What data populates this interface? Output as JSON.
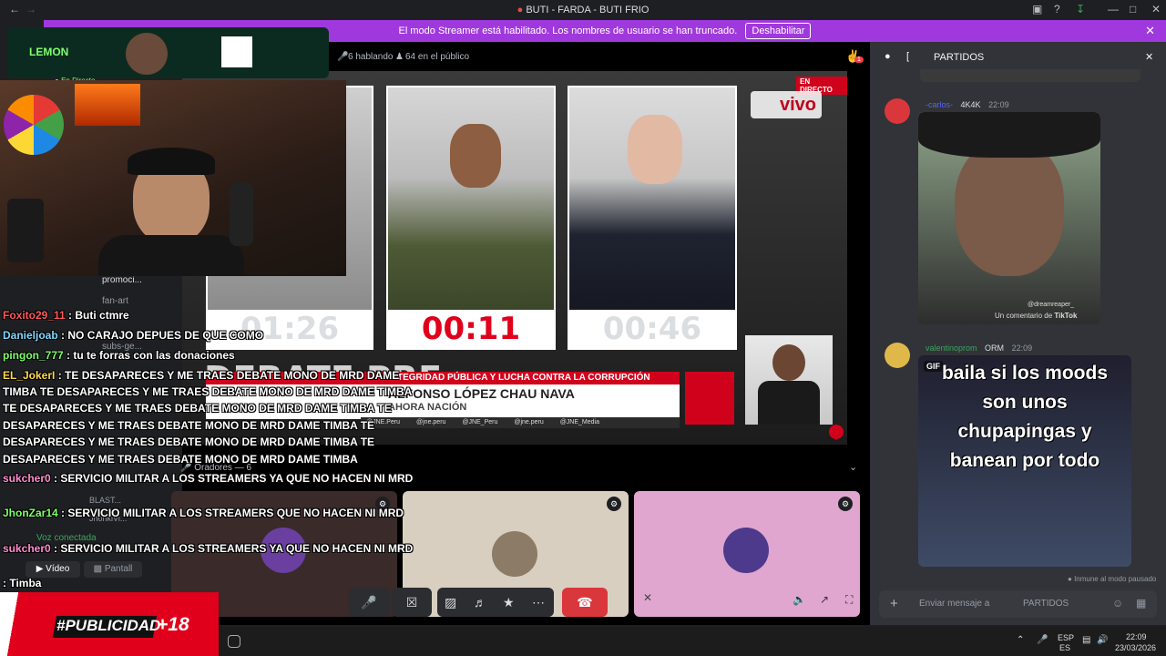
{
  "window": {
    "title": "BUTI - FARDA - BUTI FRIO",
    "controls": [
      "—",
      "□",
      "✕"
    ]
  },
  "banner": {
    "text": "El modo Streamer está habilitado. Los nombres de usuario se han truncado.",
    "button": "Deshabilitar"
  },
  "voice": {
    "talking": "6 hablando",
    "audience": "64 en el público",
    "speakers_label": "Oradores — 6",
    "notif_badge": "1"
  },
  "stage": {
    "live_badge": "EN DIRECTO",
    "vivo": "vivo",
    "timers": [
      "01:26",
      "00:11",
      "00:46"
    ],
    "ticker_red": "INTEGRIDAD PÚBLICA Y LUCHA CONTRA LA CORRUPCIÓN",
    "ticker_name": "ALFONSO LÓPEZ CHAU NAVA",
    "ticker_sub": "AHORA NACIÓN",
    "socials": [
      "@JNE.Peru",
      "@jne.peru",
      "@JNE_Peru",
      "@jne.peru",
      "@JNE_Media"
    ],
    "debate_overlay": "DEBATE PRESIDENCIAL"
  },
  "chat_panel": {
    "channel": "PARTIDOS",
    "msg1": {
      "user": "-carlos-",
      "badge": "4K4K",
      "time": "22:09",
      "caption": "Un comentario de",
      "caption_tag": "TikTok",
      "handle": "@dreamreaper_"
    },
    "msg2": {
      "user": "valentinoprom",
      "badge": "ORM",
      "time": "22:09",
      "gif_label": "GIF",
      "gif_text": "baila si los moods son unos chupapingas y banean por todo"
    },
    "footer_note": "Inmune al modo pausado",
    "input_placeholder": "Enviar mensaje a",
    "input_channel": "PARTIDOS"
  },
  "sidebar": {
    "voice_connected": "Voz conectada",
    "video_btn": "Vídeo",
    "screen_btn": "Pantall"
  },
  "overlay": {
    "brand": "LEMON",
    "live": "En Directo",
    "promo": "#PUBLICIDAD",
    "plus18": "+18"
  },
  "stream_chat": [
    {
      "user": "Foxito29_11",
      "color": "#ff5a5a",
      "text": "Buti ctmre"
    },
    {
      "user": "Danieljoab",
      "color": "#7fd7ff",
      "text": "NO CARAJO DEPUES DE QUE COMO"
    },
    {
      "user": "pingon_777",
      "color": "#7fff6a",
      "text": "tu te forras con las donaciones"
    },
    {
      "user": "EL_JokerI",
      "color": "#ffd84a",
      "text": "TE DESAPARECES Y ME TRAES DEBATE MONO DE MRD DAME"
    },
    {
      "user": "",
      "color": "#fff",
      "text": "TIMBA TE DESAPARECES Y ME TRAES DEBATE MONO DE MRD DAME TIMBA"
    },
    {
      "user": "",
      "color": "#fff",
      "text": "TE DESAPARECES Y ME TRAES DEBATE MONO DE MRD DAME TIMBA TE"
    },
    {
      "user": "",
      "color": "#fff",
      "text": "DESAPARECES Y ME TRAES DEBATE MONO DE MRD DAME TIMBA TE"
    },
    {
      "user": "",
      "color": "#fff",
      "text": "DESAPARECES Y ME TRAES DEBATE MONO DE MRD DAME TIMBA TE"
    },
    {
      "user": "",
      "color": "#fff",
      "text": "DESAPARECES Y ME TRAES DEBATE MONO DE MRD DAME TIMBA"
    },
    {
      "user": "sukcher0",
      "color": "#ff8cd0",
      "text": "SERVICIO MILITAR A LOS STREAMERS YA QUE NO HACEN NI MRD"
    },
    {
      "user": "JhonZar14",
      "color": "#7fff6a",
      "text": "SERVICIO MILITAR A LOS STREAMERS QUE NO HACEN NI MRD"
    },
    {
      "user": "sukcher0",
      "color": "#ff8cd0",
      "text": "SERVICIO MILITAR A LOS STREAMERS YA QUE NO HACEN NI MRD"
    },
    {
      "user": "",
      "color": "#fff",
      "text": "Timba"
    }
  ],
  "channels_bg": [
    "promoci...",
    "fan-art",
    "subs-ge...",
    "BLAST...",
    "JhonkiVi..."
  ],
  "taskbar": {
    "lang1": "ESP",
    "lang2": "ES",
    "time": "22:09",
    "date": "23/03/2026"
  }
}
